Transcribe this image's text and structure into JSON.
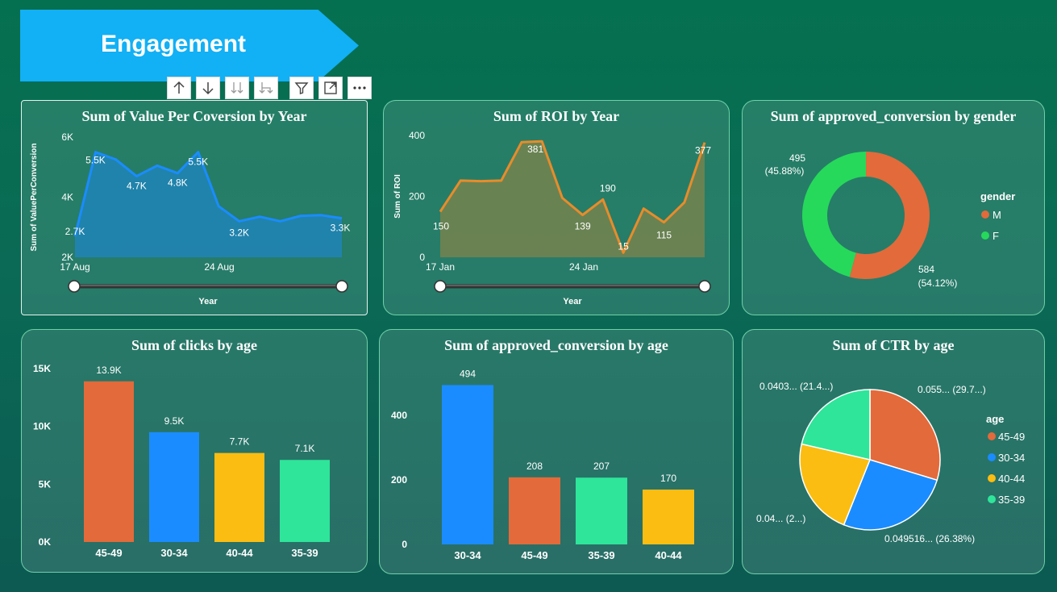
{
  "banner": {
    "title": "Engagement"
  },
  "toolbar": {
    "icons": [
      "arrow-up-icon",
      "arrow-down-icon",
      "expand-down-icon",
      "expand-all-icon",
      "filter-icon",
      "focus-mode-icon",
      "more-options-icon"
    ]
  },
  "colors": {
    "orange": "#e36a3a",
    "blue": "#1a8cff",
    "yellow": "#fbbd12",
    "mint": "#2ee59a",
    "green": "#26d95b",
    "line_blue": "#1a8cff",
    "line_orange": "#e88c2a"
  },
  "chart_data": [
    {
      "id": "value_per_conversion",
      "type": "area",
      "title": "Sum of Value Per Coversion by Year",
      "xlabel": "Year",
      "ylabel": "Sum of ValuePerConversion",
      "yticks": [
        "2K",
        "4K",
        "6K"
      ],
      "xticks": [
        "17 Aug",
        "24 Aug"
      ],
      "ylim": [
        2000,
        6000
      ],
      "values": [
        2700,
        5500,
        5250,
        4700,
        5050,
        4800,
        5500,
        3700,
        3200,
        3350,
        3200,
        3380,
        3400,
        3300
      ],
      "data_labels": [
        {
          "i": 0,
          "text": "2.7K"
        },
        {
          "i": 1,
          "text": "5.5K"
        },
        {
          "i": 3,
          "text": "4.7K"
        },
        {
          "i": 5,
          "text": "4.8K"
        },
        {
          "i": 6,
          "text": "5.5K"
        },
        {
          "i": 8,
          "text": "3.2K"
        },
        {
          "i": 13,
          "text": "3.3K"
        }
      ]
    },
    {
      "id": "roi",
      "type": "area",
      "title": "Sum of ROI by Year",
      "xlabel": "Year",
      "ylabel": "Sum of ROI",
      "yticks": [
        "0",
        "200",
        "400"
      ],
      "xticks": [
        "17 Jan",
        "24 Jan"
      ],
      "ylim": [
        0,
        400
      ],
      "values": [
        150,
        252,
        250,
        252,
        378,
        381,
        195,
        139,
        190,
        15,
        160,
        115,
        180,
        377
      ],
      "data_labels": [
        {
          "i": 0,
          "text": "150"
        },
        {
          "i": 5,
          "text": "381"
        },
        {
          "i": 7,
          "text": "139"
        },
        {
          "i": 8,
          "text": "190"
        },
        {
          "i": 9,
          "text": "15"
        },
        {
          "i": 11,
          "text": "115"
        },
        {
          "i": 13,
          "text": "377"
        }
      ]
    },
    {
      "id": "approved_by_gender",
      "type": "pie",
      "title": "Sum of approved_conversion by gender",
      "legend_title": "gender",
      "slices": [
        {
          "name": "M",
          "value": 584,
          "label": "584",
          "pct": "(54.12%)",
          "color": "#e36a3a"
        },
        {
          "name": "F",
          "value": 495,
          "label": "495",
          "pct": "(45.88%)",
          "color": "#26d95b"
        }
      ]
    },
    {
      "id": "clicks_by_age",
      "type": "bar",
      "title": "Sum of clicks by age",
      "yticks": [
        "0K",
        "5K",
        "10K",
        "15K"
      ],
      "ylim": [
        0,
        15000
      ],
      "categories": [
        "45-49",
        "30-34",
        "40-44",
        "35-39"
      ],
      "values": [
        13900,
        9500,
        7700,
        7100
      ],
      "labels": [
        "13.9K",
        "9.5K",
        "7.7K",
        "7.1K"
      ],
      "colors": [
        "#e36a3a",
        "#1a8cff",
        "#fbbd12",
        "#2ee59a"
      ]
    },
    {
      "id": "approved_by_age",
      "type": "bar",
      "title": "Sum of approved_conversion by age",
      "yticks": [
        "0",
        "200",
        "400"
      ],
      "ylim": [
        0,
        500
      ],
      "categories": [
        "30-34",
        "45-49",
        "35-39",
        "40-44"
      ],
      "values": [
        494,
        208,
        207,
        170
      ],
      "labels": [
        "494",
        "208",
        "207",
        "170"
      ],
      "colors": [
        "#1a8cff",
        "#e36a3a",
        "#2ee59a",
        "#fbbd12"
      ]
    },
    {
      "id": "ctr_by_age",
      "type": "pie",
      "title": "Sum of CTR by age",
      "legend_title": "age",
      "slices": [
        {
          "name": "45-49",
          "value": 29.7,
          "label": "0.055... (29.7...)",
          "color": "#e36a3a"
        },
        {
          "name": "30-34",
          "value": 26.38,
          "label": "0.049516... (26.38%)",
          "color": "#1a8cff"
        },
        {
          "name": "40-44",
          "value": 22.52,
          "label": "0.04... (2...)",
          "color": "#fbbd12"
        },
        {
          "name": "35-39",
          "value": 21.4,
          "label": "0.0403... (21.4...)",
          "color": "#2ee59a"
        }
      ]
    }
  ]
}
